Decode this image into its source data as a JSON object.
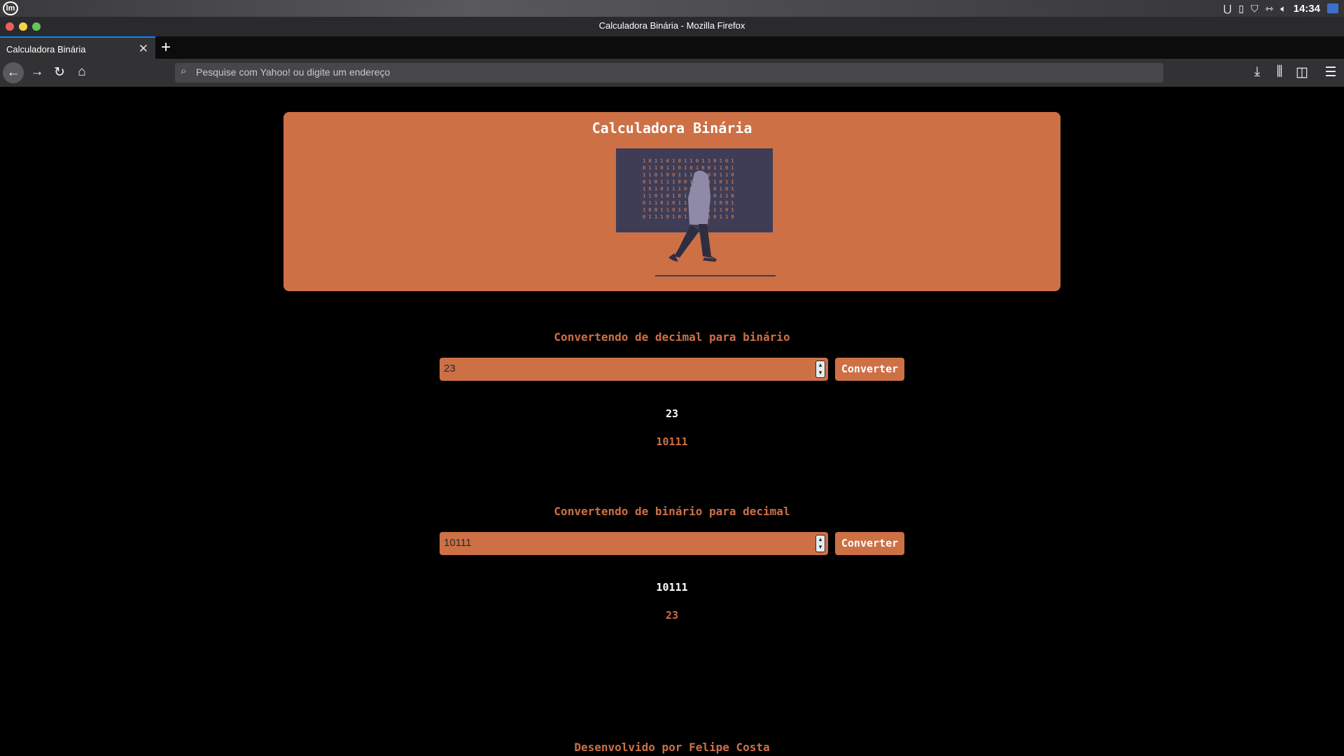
{
  "os": {
    "clock": "14:34",
    "logo": "lm",
    "tray_icons": [
      "tray-u-icon",
      "clipboard-icon",
      "shield-icon",
      "network-icon",
      "volume-icon"
    ]
  },
  "browser": {
    "window_title": "Calculadora Binária - Mozilla Firefox",
    "tab_title": "Calculadora Binária",
    "url_placeholder": "Pesquise com Yahoo! ou digite um endereço"
  },
  "page": {
    "title": "Calculadora Binária",
    "accent_color": "#cd7045",
    "decimal_to_binary": {
      "heading": "Convertendo de decimal para binário",
      "input_value": "23",
      "button_label": "Converter",
      "result_input": "23",
      "result_output": "10111"
    },
    "binary_to_decimal": {
      "heading": "Convertendo de binário para decimal",
      "input_value": "10111",
      "button_label": "Converter",
      "result_input": "10111",
      "result_output": "23"
    },
    "footer": "Desenvolvido por Felipe Costa"
  }
}
